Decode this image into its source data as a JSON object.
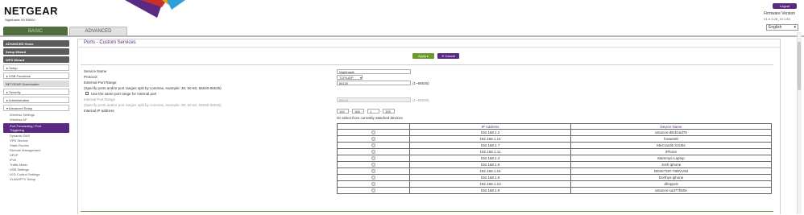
{
  "brand": {
    "logo": "NETGEAR",
    "model": "Nighthawk X6 R8000"
  },
  "tabs": {
    "basic": "BASIC",
    "advanced": "ADVANCED"
  },
  "header": {
    "logout": "Logout",
    "firmware_label": "Firmware Version",
    "firmware_version": "V1.0.4.28_10.1.54",
    "language": "English"
  },
  "sidebar": {
    "top": [
      "ADVANCED Home",
      "Setup Wizard",
      "WPS Wizard"
    ],
    "setup": "▸ Setup",
    "usb": "▸ USB Functions",
    "ngdl": "NETGEAR Downloader",
    "security": "▸ Security",
    "admin": "▸ Administration",
    "advsetup": "▾ Advanced Setup",
    "sub": [
      "Wireless Settings",
      "Wireless AP"
    ],
    "selected": [
      "Port Forwarding / Port",
      "Triggering"
    ],
    "sub2": [
      "Dynamic DNS",
      "VPN Service",
      "Static Routes",
      "Remote Management",
      "UPnP",
      "IPv6",
      "Traffic Meter",
      "USB Settings",
      "LED Control Settings",
      "VLAN/IPTV Setup"
    ]
  },
  "page": {
    "title": "Ports - Custom Services",
    "apply": "Apply ▸",
    "cancel": "✕ Cancel"
  },
  "form": {
    "service_name_label": "Service Name",
    "service_name_value": "Nighthawk",
    "protocol_label": "Protocol",
    "protocol_value": "TCP/UDP",
    "ext_range_label": "External Port Range",
    "ext_hint": "(Specify ports and/or port ranges split by commas, example: 30, 50-60, 65530-65535)",
    "ext_value": "65120",
    "ext_suffix": "(1~65535)",
    "same_label": "Use the same port range for Internal port",
    "int_range_label": "Internal Port Range",
    "int_value": "65120",
    "int_suffix": "(1~65535)",
    "int_hint": "(Specify ports and/or port ranges split by commas, example: 30, 50-60, 65530-65535)",
    "ip_label": "Internal IP address",
    "ip_parts": [
      "192",
      "168",
      "1",
      "105"
    ],
    "or_select": "Or select from currently attached devices"
  },
  "table": {
    "headers": [
      "IP Address",
      "Device Name"
    ],
    "rows": [
      {
        "ip": "192.168.1.2",
        "name": "amazon-d8cb1ad76"
      },
      {
        "ip": "192.168.1.14",
        "name": "foxwest0"
      },
      {
        "ip": "192.168.1.7",
        "name": "MeCrazd5 X2U5s"
      },
      {
        "ip": "192.168.1.11",
        "name": "iPhone"
      },
      {
        "ip": "192.168.1.4",
        "name": "Mammys-Laptop"
      },
      {
        "ip": "192.168.1.8",
        "name": "Josh-iphone"
      },
      {
        "ip": "192.168.1.15",
        "name": "DESKTOP-T8RVV93"
      },
      {
        "ip": "192.168.1.5",
        "name": "Dorthys-iphone"
      },
      {
        "ip": "192.168.1.13",
        "name": "dhnppc8"
      },
      {
        "ip": "192.168.1.9",
        "name": "amazon-ca377bb0e"
      }
    ]
  },
  "colors": {
    "purple": "#5a2a82",
    "green": "#6b9b2f",
    "dark": "#5b5b5b"
  }
}
